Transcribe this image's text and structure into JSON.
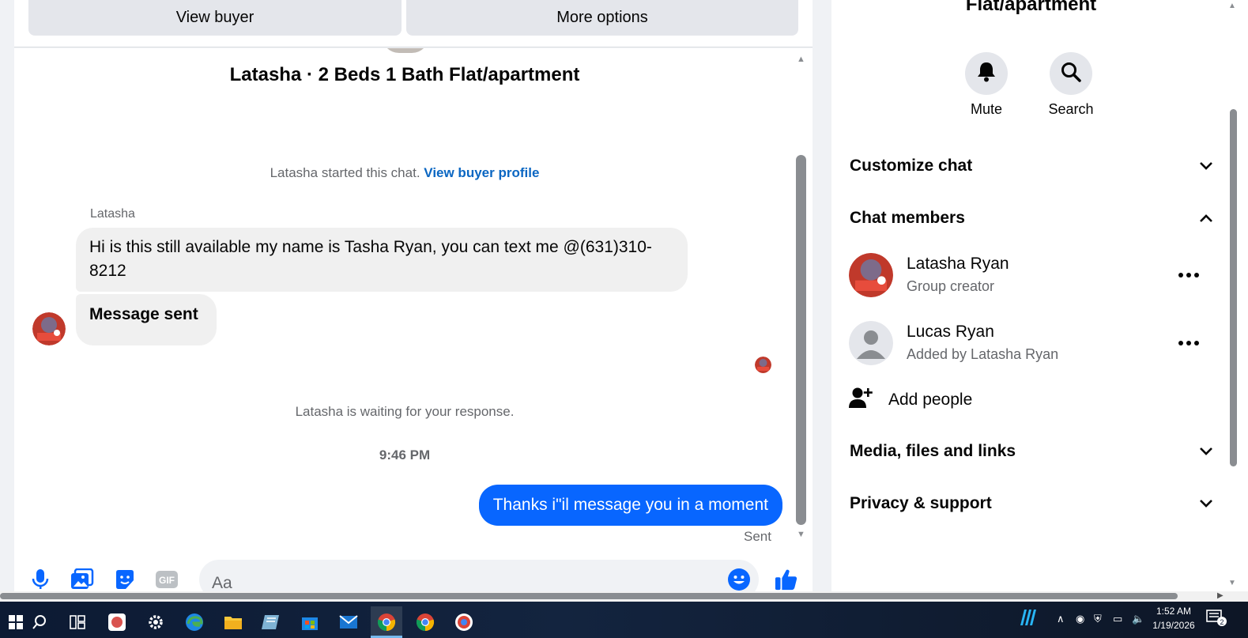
{
  "top_buttons": {
    "view_buyer": "View buyer",
    "more_options": "More options"
  },
  "chat": {
    "listing_title": "Latasha · 2 Beds 1 Bath Flat/apartment",
    "started_text": "Latasha started this chat.",
    "view_buyer_profile": "View buyer profile",
    "sender_name": "Latasha",
    "messages_in": [
      "Hi is this still available my name is Tasha Ryan, you can text me @(631)310-8212",
      "Message sent"
    ],
    "waiting_text": "Latasha is waiting for your response.",
    "timestamp": "9:46 PM",
    "message_out": "Thanks i\"il message you in a moment",
    "sent_status": "Sent"
  },
  "composer": {
    "placeholder": "Aa",
    "icons": [
      "microphone-icon",
      "photo-icon",
      "sticker-icon",
      "gif-icon",
      "emoji-icon",
      "thumbs-up-icon"
    ],
    "gif_label": "GIF"
  },
  "info": {
    "title": "Flat/apartment",
    "mute_label": "Mute",
    "search_label": "Search",
    "sections": {
      "customize_chat": "Customize chat",
      "chat_members": "Chat members",
      "media": "Media, files and links",
      "privacy": "Privacy & support"
    },
    "members": [
      {
        "name": "Latasha Ryan",
        "sub": "Group creator"
      },
      {
        "name": "Lucas Ryan",
        "sub": "Added by Latasha Ryan"
      }
    ],
    "add_people": "Add people"
  },
  "taskbar": {
    "time": "1:52 AM",
    "date": "1/19/2026",
    "notification_count": "2"
  },
  "colors": {
    "accent_blue": "#0866ff",
    "link_blue": "#0a66c2",
    "bubble_gray": "#f0f0f0",
    "button_gray": "#e4e6eb"
  }
}
